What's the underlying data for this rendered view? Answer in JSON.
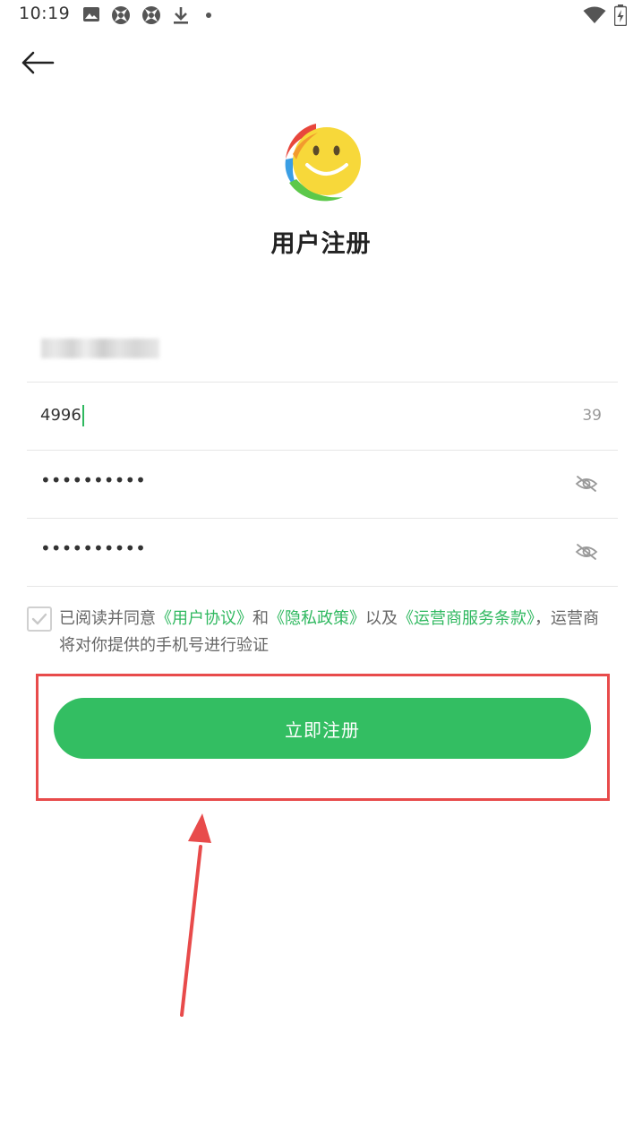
{
  "status_bar": {
    "time": "10:19",
    "icons": [
      "image-icon",
      "aperture-icon",
      "aperture-icon",
      "download-icon",
      "dot-icon",
      "wifi-icon",
      "battery-charging-icon"
    ]
  },
  "header": {
    "back_icon": "arrow-left-icon",
    "title": "用户注册"
  },
  "form": {
    "phone": {
      "value_obscured": true
    },
    "code": {
      "value": "4996",
      "countdown": "39"
    },
    "password": {
      "value": "••••••••••",
      "toggle_icon": "eye-off-icon"
    },
    "confirm_password": {
      "value": "••••••••••",
      "toggle_icon": "eye-off-icon"
    }
  },
  "agreement": {
    "checked": true,
    "prefix": "已阅读并同意",
    "link1": "《用户协议》",
    "and": "和",
    "link2": "《隐私政策》",
    "also": "以及",
    "link3": "《运营商服务条款》",
    "suffix": "，运营商将对你提供的手机号进行验证"
  },
  "register_button": {
    "label": "立即注册"
  },
  "colors": {
    "accent": "#33be62",
    "link": "#2fb85f",
    "highlight": "#e84b4b"
  }
}
